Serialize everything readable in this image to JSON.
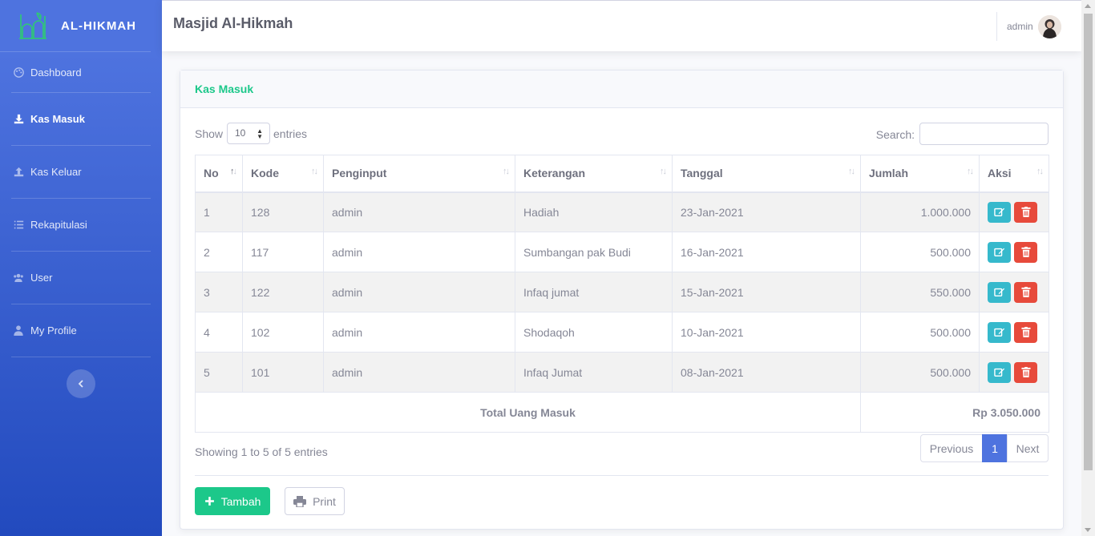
{
  "sidebar": {
    "brand": "AL-HIKMAH",
    "items": [
      {
        "label": "Dashboard",
        "icon": "palette-icon",
        "active": false
      },
      {
        "label": "Kas Masuk",
        "icon": "download-icon",
        "active": true
      },
      {
        "label": "Kas Keluar",
        "icon": "upload-icon",
        "active": false
      },
      {
        "label": "Rekapitulasi",
        "icon": "list-icon",
        "active": false
      },
      {
        "label": "User",
        "icon": "users-icon",
        "active": false
      },
      {
        "label": "My Profile",
        "icon": "user-icon",
        "active": false
      }
    ],
    "toggle_icon": "chevron-left-icon"
  },
  "topbar": {
    "title": "Masjid Al-Hikmah",
    "user": "admin"
  },
  "card": {
    "title": "Kas Masuk",
    "show_label": "Show",
    "page_length": "10",
    "entries_label": "entries",
    "search_label": "Search:",
    "search_value": ""
  },
  "table": {
    "columns": [
      "No",
      "Kode",
      "Penginput",
      "Keterangan",
      "Tanggal",
      "Jumlah",
      "Aksi"
    ],
    "rows": [
      {
        "no": "1",
        "kode": "128",
        "penginput": "admin",
        "keterangan": "Hadiah",
        "tanggal": "23-Jan-2021",
        "jumlah": "1.000.000"
      },
      {
        "no": "2",
        "kode": "117",
        "penginput": "admin",
        "keterangan": "Sumbangan pak Budi",
        "tanggal": "16-Jan-2021",
        "jumlah": "500.000"
      },
      {
        "no": "3",
        "kode": "122",
        "penginput": "admin",
        "keterangan": "Infaq jumat",
        "tanggal": "15-Jan-2021",
        "jumlah": "550.000"
      },
      {
        "no": "4",
        "kode": "102",
        "penginput": "admin",
        "keterangan": "Shodaqoh",
        "tanggal": "10-Jan-2021",
        "jumlah": "500.000"
      },
      {
        "no": "5",
        "kode": "101",
        "penginput": "admin",
        "keterangan": "Infaq Jumat",
        "tanggal": "08-Jan-2021",
        "jumlah": "500.000"
      }
    ],
    "total_label": "Total Uang Masuk",
    "total_value": "Rp 3.050.000"
  },
  "footer": {
    "info": "Showing 1 to 5 of 5 entries",
    "prev": "Previous",
    "page": "1",
    "next": "Next",
    "add_label": "Tambah",
    "print_label": "Print"
  },
  "colors": {
    "sidebar_top": "#4e73df",
    "sidebar_bottom": "#224abe",
    "success": "#1cc88a",
    "info": "#36b9cc",
    "danger": "#e74a3b",
    "primary": "#4e73df"
  }
}
